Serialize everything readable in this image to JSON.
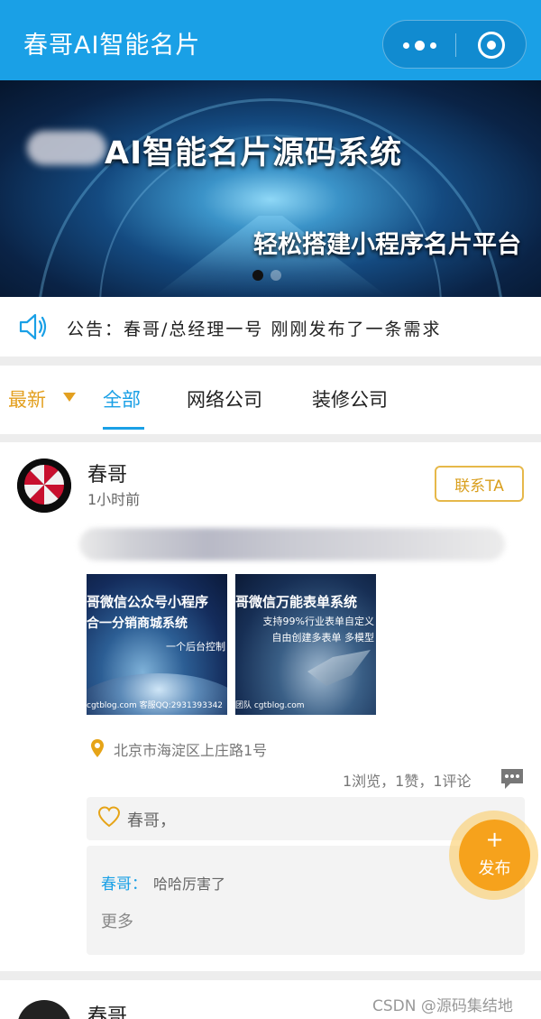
{
  "app": {
    "title": "春哥AI智能名片",
    "theme_color": "#1aa0e6",
    "accent_color": "#e3a020"
  },
  "banner": {
    "headline": "AI智能名片源码系统",
    "subtitle": "轻松搭建小程序名片平台",
    "slides_total": 2,
    "active_slide": 1
  },
  "notice": {
    "text": "公告：春哥/总经理一号 刚刚发布了一条需求"
  },
  "tabs": {
    "sort_label": "最新",
    "items": [
      {
        "label": "全部",
        "active": true
      },
      {
        "label": "网络公司",
        "active": false
      },
      {
        "label": "装修公司",
        "active": false
      }
    ]
  },
  "post": {
    "author": "春哥",
    "time": "1小时前",
    "contact_label": "联系TA",
    "images": [
      {
        "line1": "哥微信公众号小程序",
        "line2": "合一分销商城系统",
        "line3": "一个后台控制",
        "footer": "cgtblog.com 客服QQ:2931393342"
      },
      {
        "line1": "哥微信万能表单系统",
        "line2": "支持99%行业表单自定义",
        "line3": "自由创建多表单 多模型",
        "footer": "团队 cgtblog.com"
      }
    ],
    "location": "北京市海淀区上庄路1号",
    "stats": "1浏览，1赞，1评论",
    "likes_text": "春哥，",
    "comments": [
      {
        "author": "春哥",
        "separator": "：",
        "text": "哈哈厉害了"
      }
    ],
    "more_label": "更多"
  },
  "fab": {
    "plus": "+",
    "label": "发布"
  },
  "next_post": {
    "author": "春哥"
  },
  "watermark": "CSDN @源码集结地"
}
